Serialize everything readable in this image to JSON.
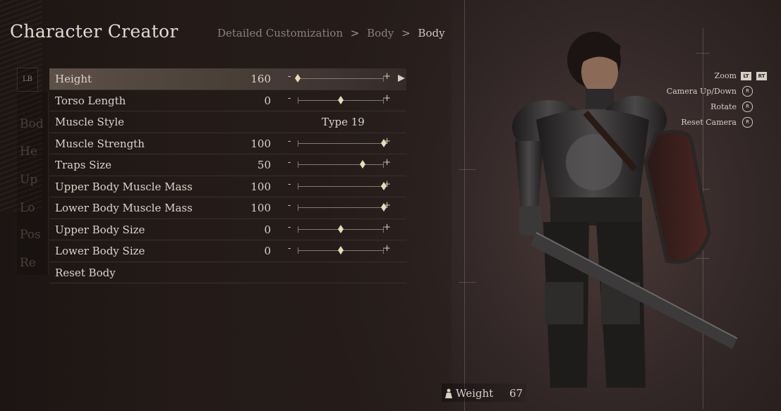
{
  "header": {
    "title": "Character Creator",
    "breadcrumb": [
      "Detailed Customization",
      "Body",
      "Body"
    ],
    "separator": ">"
  },
  "side_nav": {
    "bumper_label": "LB",
    "ghost_items": [
      "Bod",
      "He",
      "Up",
      "Lo",
      "Pos",
      "Re"
    ]
  },
  "settings": [
    {
      "label": "Height",
      "value": "160",
      "type": "slider",
      "level": 0.0,
      "selected": true
    },
    {
      "label": "Torso Length",
      "value": "0",
      "type": "slider",
      "level": 0.5
    },
    {
      "label": "Muscle Style",
      "value": "Type 19",
      "type": "select"
    },
    {
      "label": "Muscle Strength",
      "value": "100",
      "type": "slider",
      "level": 1.0
    },
    {
      "label": "Traps Size",
      "value": "50",
      "type": "slider",
      "level": 0.75
    },
    {
      "label": "Upper Body Muscle Mass",
      "value": "100",
      "type": "slider",
      "level": 1.0
    },
    {
      "label": "Lower Body Muscle Mass",
      "value": "100",
      "type": "slider",
      "level": 1.0
    },
    {
      "label": "Upper Body Size",
      "value": "0",
      "type": "slider",
      "level": 0.5
    },
    {
      "label": "Lower Body Size",
      "value": "0",
      "type": "slider",
      "level": 0.5
    },
    {
      "label": "Reset Body",
      "value": "",
      "type": "action"
    }
  ],
  "slider_signs": {
    "minus": "-",
    "plus": "+"
  },
  "camera_hints": [
    {
      "label": "Zoom",
      "keys": [
        "LT",
        "RT"
      ]
    },
    {
      "label": "Camera Up/Down",
      "keys": [
        "R"
      ]
    },
    {
      "label": "Rotate",
      "keys": [
        "R"
      ]
    },
    {
      "label": "Reset Camera",
      "keys": [
        "R"
      ]
    }
  ],
  "weight": {
    "label": "Weight",
    "value": "67"
  },
  "colors": {
    "accent": "#d8cfc4",
    "selected_row": "#5d5049",
    "background": "#2a201c"
  }
}
